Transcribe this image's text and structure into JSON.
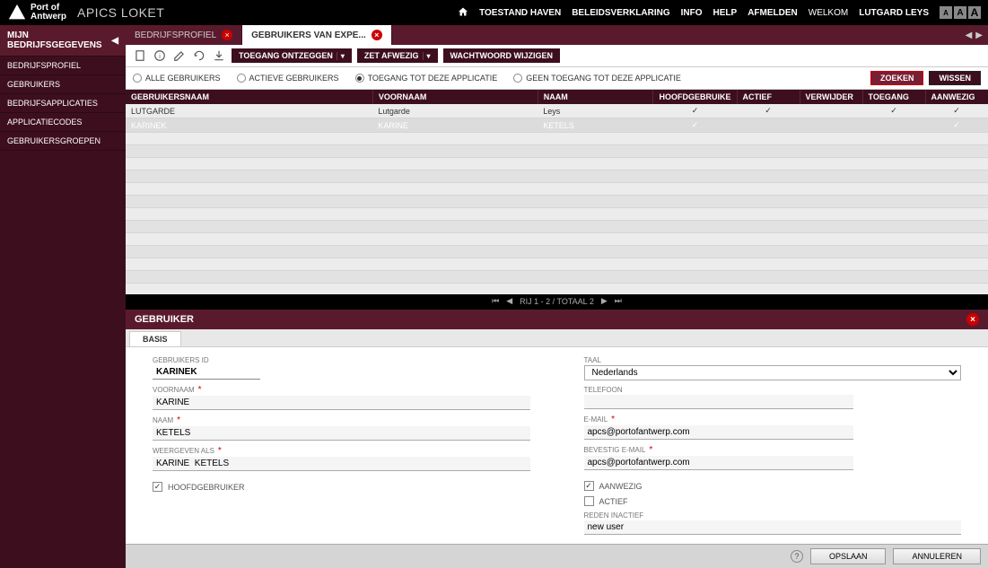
{
  "header": {
    "logo_line1": "Port of",
    "logo_line2": "Antwerp",
    "app_title": "APICS LOKET",
    "nav": {
      "toestand": "TOESTAND HAVEN",
      "beleid": "BELEIDSVERKLARING",
      "info": "INFO",
      "help": "HELP",
      "afmelden": "AFMELDEN"
    },
    "welcome": "WELKOM",
    "user": "LUTGARD LEYS",
    "font_a": "A"
  },
  "sidebar": {
    "title": "MIJN BEDRIJFSGEGEVENS",
    "items": [
      "BEDRIJFSPROFIEL",
      "GEBRUIKERS",
      "BEDRIJFSAPPLICATIES",
      "APPLICATIECODES",
      "GEBRUIKERSGROEPEN"
    ]
  },
  "tabs": {
    "t0": "BEDRIJFSPROFIEL",
    "t1": "GEBRUIKERS VAN EXPE..."
  },
  "toolbar": {
    "btn_ontzeggen": "TOEGANG ONTZEGGEN",
    "btn_afwezig": "ZET AFWEZIG",
    "btn_wachtwoord": "WACHTWOORD WIJZIGEN"
  },
  "filters": {
    "alle": "ALLE GEBRUIKERS",
    "actieve": "ACTIEVE GEBRUIKERS",
    "toegang": "TOEGANG TOT DEZE APPLICATIE",
    "geen": "GEEN TOEGANG TOT DEZE APPLICATIE",
    "zoeken": "ZOEKEN",
    "wissen": "WISSEN"
  },
  "table": {
    "cols": {
      "gebruikersnaam": "GEBRUIKERSNAAM",
      "voornaam": "VOORNAAM",
      "naam": "NAAM",
      "hoofd": "HOOFDGEBRUIKE",
      "actief": "ACTIEF",
      "verwijder": "VERWIJDER",
      "toegang": "TOEGANG",
      "aanwezig": "AANWEZIG"
    },
    "rows": [
      {
        "gn": "LUTGARDE",
        "vn": "Lutgarde",
        "nm": "Leys",
        "hoofd": "✓",
        "actief": "✓",
        "verw": "",
        "toeg": "✓",
        "aanw": "✓"
      },
      {
        "gn": "KARINEK",
        "vn": "KARINE",
        "nm": "KETELS",
        "hoofd": "✓",
        "actief": "",
        "verw": "",
        "toeg": "",
        "aanw": "✓"
      }
    ]
  },
  "pager": {
    "text": "RIJ 1 - 2 / TOTAAL 2"
  },
  "detail": {
    "title": "GEBRUIKER",
    "tab": "BASIS",
    "labels": {
      "id": "GEBRUIKERS ID",
      "voornaam": "VOORNAAM",
      "naam": "NAAM",
      "weergeven": "WEERGEVEN ALS",
      "hoofd": "HOOFDGEBRUIKER",
      "taal": "TAAL",
      "telefoon": "TELEFOON",
      "email": "E-MAIL",
      "bevestig": "BEVESTIG E-MAIL",
      "aanwezig": "AANWEZIG",
      "actief": "ACTIEF",
      "reden": "REDEN INACTIEF"
    },
    "values": {
      "id": "KARINEK",
      "voornaam": "KARINE",
      "naam": "KETELS",
      "weergeven": "KARINE  KETELS",
      "taal": "Nederlands",
      "telefoon": "",
      "email": "apcs@portofantwerp.com",
      "bevestig": "apcs@portofantwerp.com",
      "reden": "new user"
    }
  },
  "footer": {
    "opslaan": "OPSLAAN",
    "annuleren": "ANNULEREN"
  }
}
